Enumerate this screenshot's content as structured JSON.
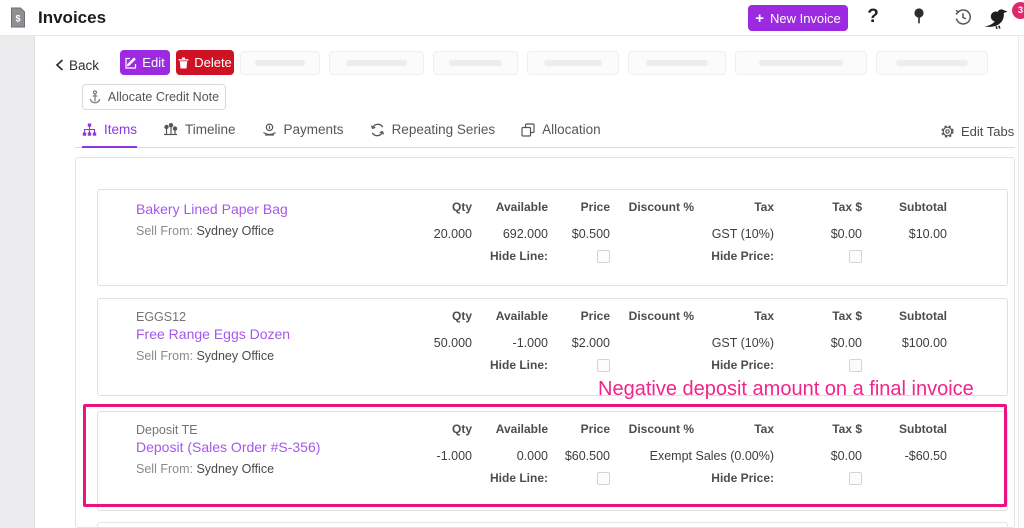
{
  "header": {
    "title": "Invoices",
    "new_invoice": {
      "plus": "+",
      "label": "New Invoice"
    },
    "help": "?",
    "notification_badge": "3"
  },
  "toolbar": {
    "back": "Back",
    "edit": "Edit",
    "delete": "Delete",
    "allocate_credit_note": "Allocate Credit Note"
  },
  "tabs": {
    "list": [
      {
        "label": "Items"
      },
      {
        "label": "Timeline"
      },
      {
        "label": "Payments"
      },
      {
        "label": "Repeating Series"
      },
      {
        "label": "Allocation"
      }
    ],
    "edit_tabs": "Edit Tabs"
  },
  "annotation": "Negative deposit amount on a final invoice",
  "items_section": {
    "columns": [
      "Qty",
      "Available",
      "Price",
      "Discount %",
      "Tax",
      "Tax $",
      "Subtotal"
    ],
    "hide_line": "Hide Line:",
    "hide_price": "Hide Price:",
    "sell_from": "Sell From:",
    "rows": [
      {
        "sku": "",
        "name": "Bakery Lined Paper Bag",
        "location": "Sydney Office",
        "qty": "20.000",
        "available": "692.000",
        "price": "$0.500",
        "discount": "",
        "tax": "GST (10%)",
        "tax_amt": "$0.00",
        "subtotal": "$10.00"
      },
      {
        "sku": "EGGS12",
        "name": "Free Range Eggs Dozen",
        "location": "Sydney Office",
        "qty": "50.000",
        "available": "-1.000",
        "price": "$2.000",
        "discount": "",
        "tax": "GST (10%)",
        "tax_amt": "$0.00",
        "subtotal": "$100.00"
      },
      {
        "sku": "Deposit TE",
        "name": "Deposit (Sales Order #S-356)",
        "location": "Sydney Office",
        "qty": "-1.000",
        "available": "0.000",
        "price": "$60.500",
        "discount": "",
        "tax": "Exempt Sales (0.00%)",
        "tax_amt": "$0.00",
        "subtotal": "-$60.50"
      }
    ]
  },
  "colors": {
    "accent_purple": "#9b2ae0",
    "active_tab_purple": "#8f36e4",
    "link_purple": "#a558ea",
    "danger_red": "#cf1124",
    "annotation_pink": "#f1238d",
    "highlight_border": "#ea1380",
    "badge_pink": "#e0266f"
  }
}
